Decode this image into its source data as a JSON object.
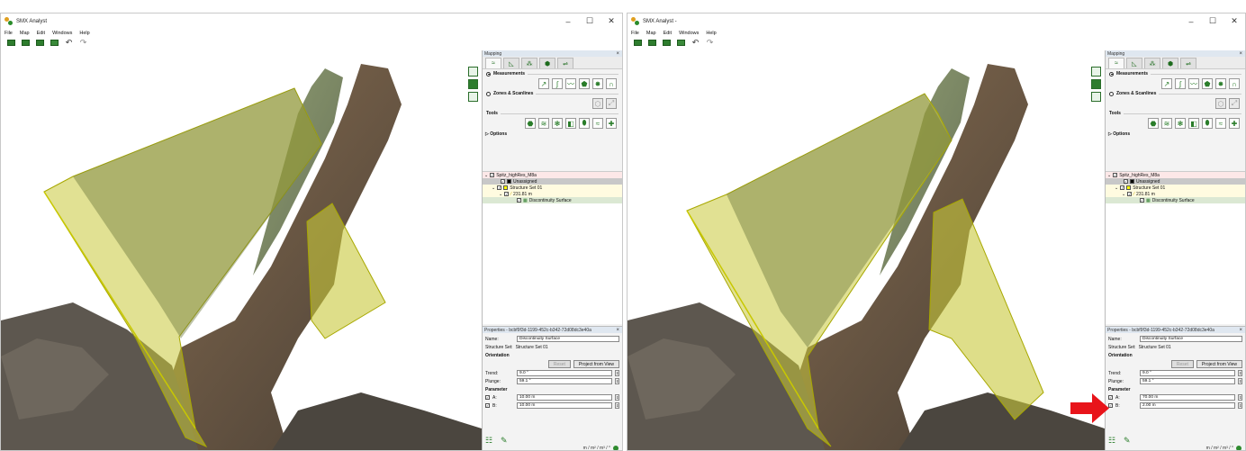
{
  "windows": [
    {
      "id": "w1",
      "title": "SMX Analyst",
      "menu": [
        "File",
        "Map",
        "Edit",
        "Windows",
        "Help"
      ],
      "mapping_title": "Mapping",
      "measurements_label": "Measurements",
      "zones_label": "Zones & Scanlines",
      "tools_label": "Tools",
      "options_label": "Options",
      "tree": {
        "root": "Spitz_highRes_M8a",
        "unassigned": "Unassigned",
        "structure_set": "Structure Set 01",
        "measurement": "231.81 m",
        "surface": "Discontinuity Surface"
      },
      "properties": {
        "header": "Properties - bcbf9f3d-1199-452c-b342-72d08dc3e40a",
        "name_label": "Name:",
        "name_value": "Discontinuity Surface",
        "structure_set_label": "Structure Set:",
        "structure_set_value": "Structure Set 01",
        "orientation_label": "Orientation",
        "reset_label": "Reset",
        "project_label": "Project from View",
        "trend_label": "Trend:",
        "trend_value": "9.0 °",
        "plunge_label": "Plunge:",
        "plunge_value": "59.1 °",
        "parameter_label": "Parameter",
        "a_label": "A:",
        "a_value": "10.00 m",
        "b_label": "B:",
        "b_value": "10.00 m"
      },
      "units": "m / m² / m³ / °"
    },
    {
      "id": "w2",
      "title": "SMX Analyst -",
      "menu": [
        "File",
        "Map",
        "Edit",
        "Windows",
        "Help"
      ],
      "mapping_title": "Mapping",
      "measurements_label": "Measurements",
      "zones_label": "Zones & Scanlines",
      "tools_label": "Tools",
      "options_label": "Options",
      "tree": {
        "root": "Spitz_highRes_M8a",
        "unassigned": "Unassigned",
        "structure_set": "Structure Set 01",
        "measurement": "231.81 m",
        "surface": "Discontinuity Surface"
      },
      "properties": {
        "header": "Properties - bcbf9f3d-1199-452c-b342-72d08dc3e40a",
        "name_label": "Name:",
        "name_value": "Discontinuity Surface",
        "structure_set_label": "Structure Set:",
        "structure_set_value": "Structure Set 01",
        "orientation_label": "Orientation",
        "reset_label": "Reset",
        "project_label": "Project from View",
        "trend_label": "Trend:",
        "trend_value": "9.0 °",
        "plunge_label": "Plunge:",
        "plunge_value": "59.1 °",
        "parameter_label": "Parameter",
        "a_label": "A:",
        "a_value": "70.00 m",
        "b_label": "B:",
        "b_value": "2.00 m"
      },
      "units": "m / m² / m³ / °"
    }
  ],
  "colors": {
    "plane_fill": "#c8c83a",
    "plane_edge": "#a8a800",
    "accent_green": "#2e7d2e",
    "arrow_red": "#e8141a"
  }
}
